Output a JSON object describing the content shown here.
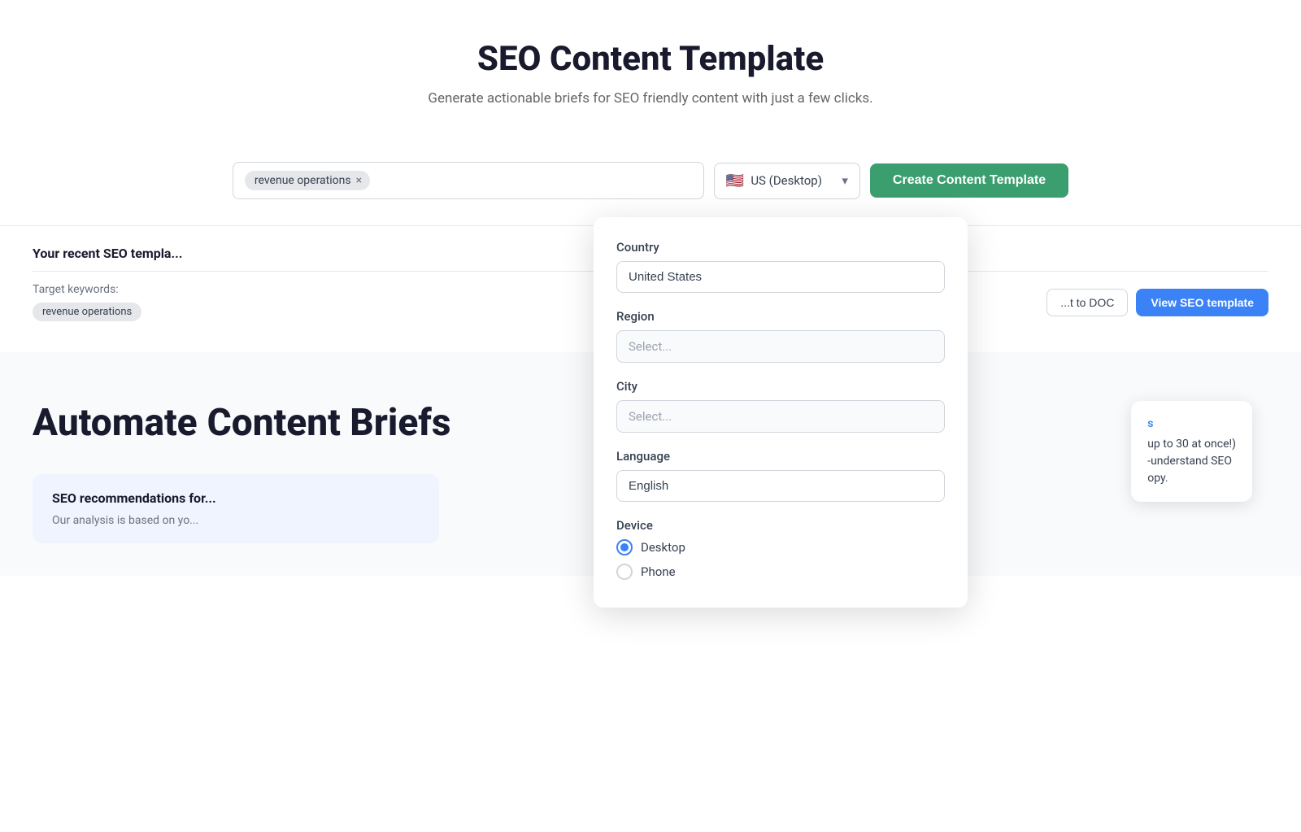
{
  "page": {
    "title": "SEO Content Template",
    "subtitle": "Generate actionable briefs for SEO friendly content with just a few clicks."
  },
  "search": {
    "keyword_tag": "revenue operations",
    "keyword_tag_close": "×",
    "input_placeholder": ""
  },
  "locale": {
    "flag": "🇺🇸",
    "label": "US (Desktop)",
    "chevron": "▾"
  },
  "create_button": "Create Content Template",
  "dropdown": {
    "country_label": "Country",
    "country_value": "United States",
    "region_label": "Region",
    "region_placeholder": "Select...",
    "city_label": "City",
    "city_placeholder": "Select...",
    "language_label": "Language",
    "language_value": "English",
    "device_label": "Device",
    "device_options": [
      {
        "label": "Desktop",
        "selected": true
      },
      {
        "label": "Phone",
        "selected": false
      }
    ]
  },
  "recent": {
    "title": "Your recent SEO templa...",
    "target_keywords_label": "Target keywords:",
    "keyword_tag": "revenue operations",
    "export_doc_label": "...t to DOC",
    "view_seo_label": "View SEO template"
  },
  "automate": {
    "title_left": "Automate",
    "title_right": "Content Briefs"
  },
  "promo": {
    "link": "s",
    "line1": "up to 30 at once!)",
    "line2": "-understand SEO",
    "line3": "opy."
  },
  "seo_rec": {
    "title": "SEO recommendations for...",
    "body": "Our analysis is based on yo..."
  }
}
